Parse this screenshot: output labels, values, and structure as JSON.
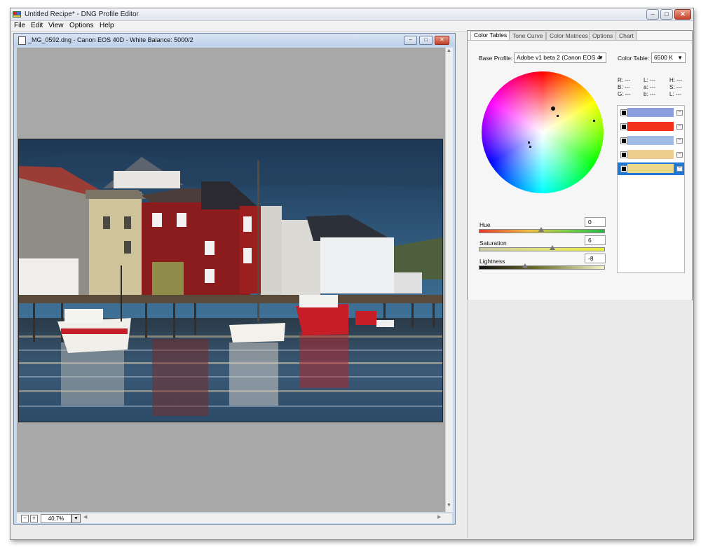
{
  "app": {
    "title": "Untitled Recipe* - DNG Profile Editor",
    "window_buttons": [
      "–",
      "□",
      "✕"
    ]
  },
  "menu": [
    "File",
    "Edit",
    "View",
    "Options",
    "Help"
  ],
  "document": {
    "title": "_MG_0592.dng  - Canon EOS 40D - White Balance: 5000/2",
    "buttons": [
      "–",
      "□",
      "✕"
    ],
    "zoom_minus": "−",
    "zoom_plus": "+",
    "zoom_value": "40,7%",
    "zoom_drop": "▼",
    "scroll_up": "▲",
    "scroll_down": "▼",
    "scroll_left": "◀",
    "scroll_right": "▶"
  },
  "panel": {
    "tabs": [
      "Color Tables",
      "Tone Curve",
      "Color Matrices",
      "Options",
      "Chart"
    ],
    "active_tab": "Color Tables",
    "base_profile_label": "Base Profile:",
    "base_profile_value": "Adobe v1 beta 2 (Canon EOS 4",
    "color_table_label": "Color Table:",
    "color_table_value": "6500 K",
    "dropdown_arrow": "▼",
    "readouts": {
      "r": "R: ---",
      "b": "B: ---",
      "g": "G: ---",
      "l": "L: ---",
      "a": "a: ---",
      "b2": "b: ---",
      "h": "H: ---",
      "s": "S: ---",
      "l2": "L: ---"
    },
    "sliders": [
      {
        "label": "Hue",
        "value": "0",
        "level": 0.5
      },
      {
        "label": "Saturation",
        "value": "6",
        "level": 0.59
      },
      {
        "label": "Lightness",
        "value": "-8",
        "level": 0.37
      }
    ],
    "swatches": [
      {
        "color": "#8a9ee0",
        "selected": false
      },
      {
        "color": "#f2321c",
        "selected": false
      },
      {
        "color": "#9fbbe6",
        "selected": false
      },
      {
        "color": "#eccd8c",
        "selected": false
      },
      {
        "color": "#ecd98c",
        "selected": true
      }
    ],
    "swatch_remove": "−"
  }
}
